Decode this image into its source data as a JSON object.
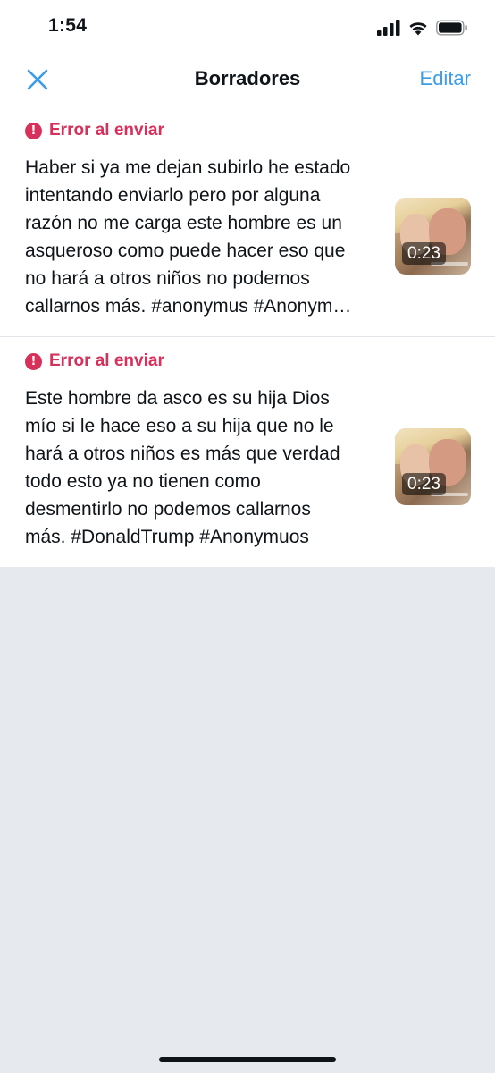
{
  "status_bar": {
    "time": "1:54",
    "icons": [
      "signal-icon",
      "wifi-icon",
      "battery-icon"
    ]
  },
  "nav": {
    "title": "Borradores",
    "edit_label": "Editar",
    "close_icon": "close-icon"
  },
  "drafts": [
    {
      "error_label": "Error al enviar",
      "error_icon": "!",
      "text": "Haber si ya me dejan subirlo he estado\nintentando enviarlo pero por alguna\nrazón no me carga este hombre es un\nasqueroso como puede hacer eso que\nno hará a otros niños no podemos\ncallarnos más. #anonymus #Anonym…",
      "duration": "0:23"
    },
    {
      "error_label": "Error al enviar",
      "error_icon": "!",
      "text": "Este hombre da asco es su hija Dios\nmío si le hace eso a su hija que no le\nhará a otros niños es más que verdad\ntodo esto ya no tienen como\ndesmentirlo no podemos callarnos\nmás. #DonaldTrump #Anonymuos",
      "duration": "0:23"
    }
  ],
  "colors": {
    "accent": "#3a9de8",
    "error": "#d7305b",
    "text": "#0f1419",
    "background": "#e6e9ee"
  }
}
